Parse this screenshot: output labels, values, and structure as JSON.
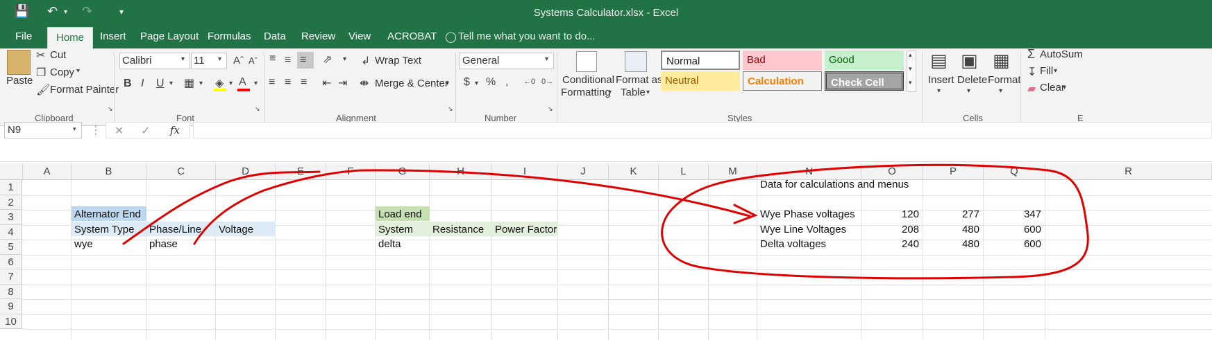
{
  "window": {
    "title": "Systems Calculator.xlsx - Excel"
  },
  "tabs": [
    "File",
    "Home",
    "Insert",
    "Page Layout",
    "Formulas",
    "Data",
    "Review",
    "View",
    "ACROBAT"
  ],
  "tell_me": "Tell me what you want to do...",
  "clipboard": {
    "paste": "Paste",
    "cut": "Cut",
    "copy": "Copy",
    "format_painter": "Format Painter",
    "label": "Clipboard"
  },
  "font": {
    "name": "Calibri",
    "size": "11",
    "label": "Font"
  },
  "alignment": {
    "wrap": "Wrap Text",
    "merge": "Merge & Center",
    "label": "Alignment"
  },
  "number": {
    "format": "General",
    "label": "Number"
  },
  "styles": {
    "conditional": [
      "Conditional",
      "Formatting"
    ],
    "format_table": [
      "Format as",
      "Table"
    ],
    "normal": "Normal",
    "bad": "Bad",
    "good": "Good",
    "neutral": "Neutral",
    "calculation": "Calculation",
    "check_cell": "Check Cell",
    "label": "Styles"
  },
  "cells_group": {
    "insert": "Insert",
    "delete": "Delete",
    "format": "Format",
    "label": "Cells"
  },
  "editing": {
    "autosum": "AutoSum",
    "fill": "Fill",
    "clear": "Clear",
    "label_fragment": "E"
  },
  "formula_bar": {
    "name_box": "N9",
    "fx": "fx",
    "formula": ""
  },
  "grid": {
    "columns": [
      "A",
      "B",
      "C",
      "D",
      "E",
      "F",
      "G",
      "H",
      "I",
      "J",
      "K",
      "L",
      "M",
      "N",
      "O",
      "P",
      "Q",
      "R"
    ],
    "rows": [
      "1",
      "2",
      "3",
      "4",
      "5",
      "6",
      "7",
      "8",
      "9",
      "10"
    ],
    "cells": {
      "N2": "Data for calculations and menus",
      "B4": "Alternator End",
      "B5": "System Type",
      "C5": "Phase/Line",
      "D5": "Voltage",
      "B6": "wye",
      "C6": "phase",
      "G4": "Load end",
      "G5": "System",
      "H5": "Resistance",
      "I5": "Power Factor",
      "G6": "delta",
      "N4": "Wye Phase voltages",
      "O4": "120",
      "P4": "277",
      "Q4": "347",
      "N5": "Wye Line Voltages",
      "O5": "208",
      "P5": "480",
      "Q5": "600",
      "N6": "Delta voltages",
      "O6": "240",
      "P6": "480",
      "Q6": "600"
    }
  },
  "colors": {
    "excel_green": "#217346",
    "alternator_fill": "#bdd7ee",
    "alternator_header_fill": "#ddebf7",
    "load_fill": "#c6e0b4",
    "load_header_fill": "#e2efda",
    "annotation_red": "#e00000"
  }
}
